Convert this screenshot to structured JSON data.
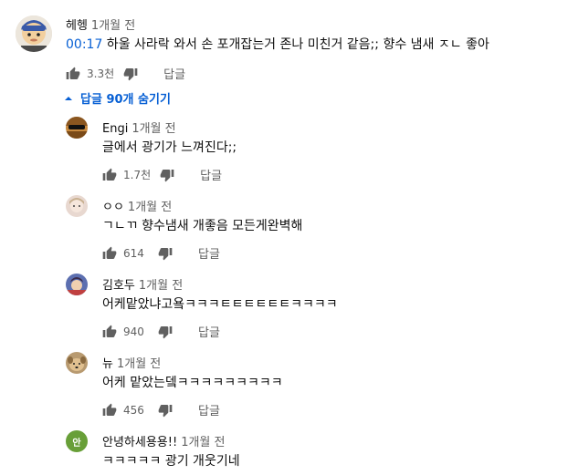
{
  "top_comment": {
    "author": "헤헹",
    "time": "1개월 전",
    "timestamp_link": "00:17",
    "text": " 하울 사라락 와서 손 포개잡는거 존나 미친거 같음;; 향수 냄새 ㅈㄴ 좋아",
    "likes": "3.3천",
    "reply_label": "답글"
  },
  "hide_replies_label": "답글 90개 숨기기",
  "replies": [
    {
      "author": "Engi",
      "time": "1개월 전",
      "text": "글에서 광기가 느껴진다;;",
      "likes": "1.7천",
      "reply_label": "답글"
    },
    {
      "author": "ㅇㅇ",
      "time": "1개월 전",
      "text": "ㄱㄴㄲ 향수냄새 개좋음 모든게완벽해",
      "likes": "614",
      "reply_label": "답글"
    },
    {
      "author": "김호두",
      "time": "1개월 전",
      "text": "어케맡았냐고욬ㅋㅋㅋㅌㅌㅌㅌㅌㅌㅋㅋㅋㅋ",
      "likes": "940",
      "reply_label": "답글"
    },
    {
      "author": "뉴",
      "time": "1개월 전",
      "text": "어케 맡았는뎈ㅋㅋㅋㅋㅋㅋㅋㅋㅋ",
      "likes": "456",
      "reply_label": "답글"
    },
    {
      "author": "안녕하세용용!!",
      "time": "1개월 전",
      "text": "ㅋㅋㅋㅋㅋ 광기 개웃기네",
      "avatar_letter": "안"
    }
  ],
  "colors": {
    "link_blue": "#065fd4",
    "secondary_text": "#606060",
    "avatar_green": "#689f38"
  }
}
